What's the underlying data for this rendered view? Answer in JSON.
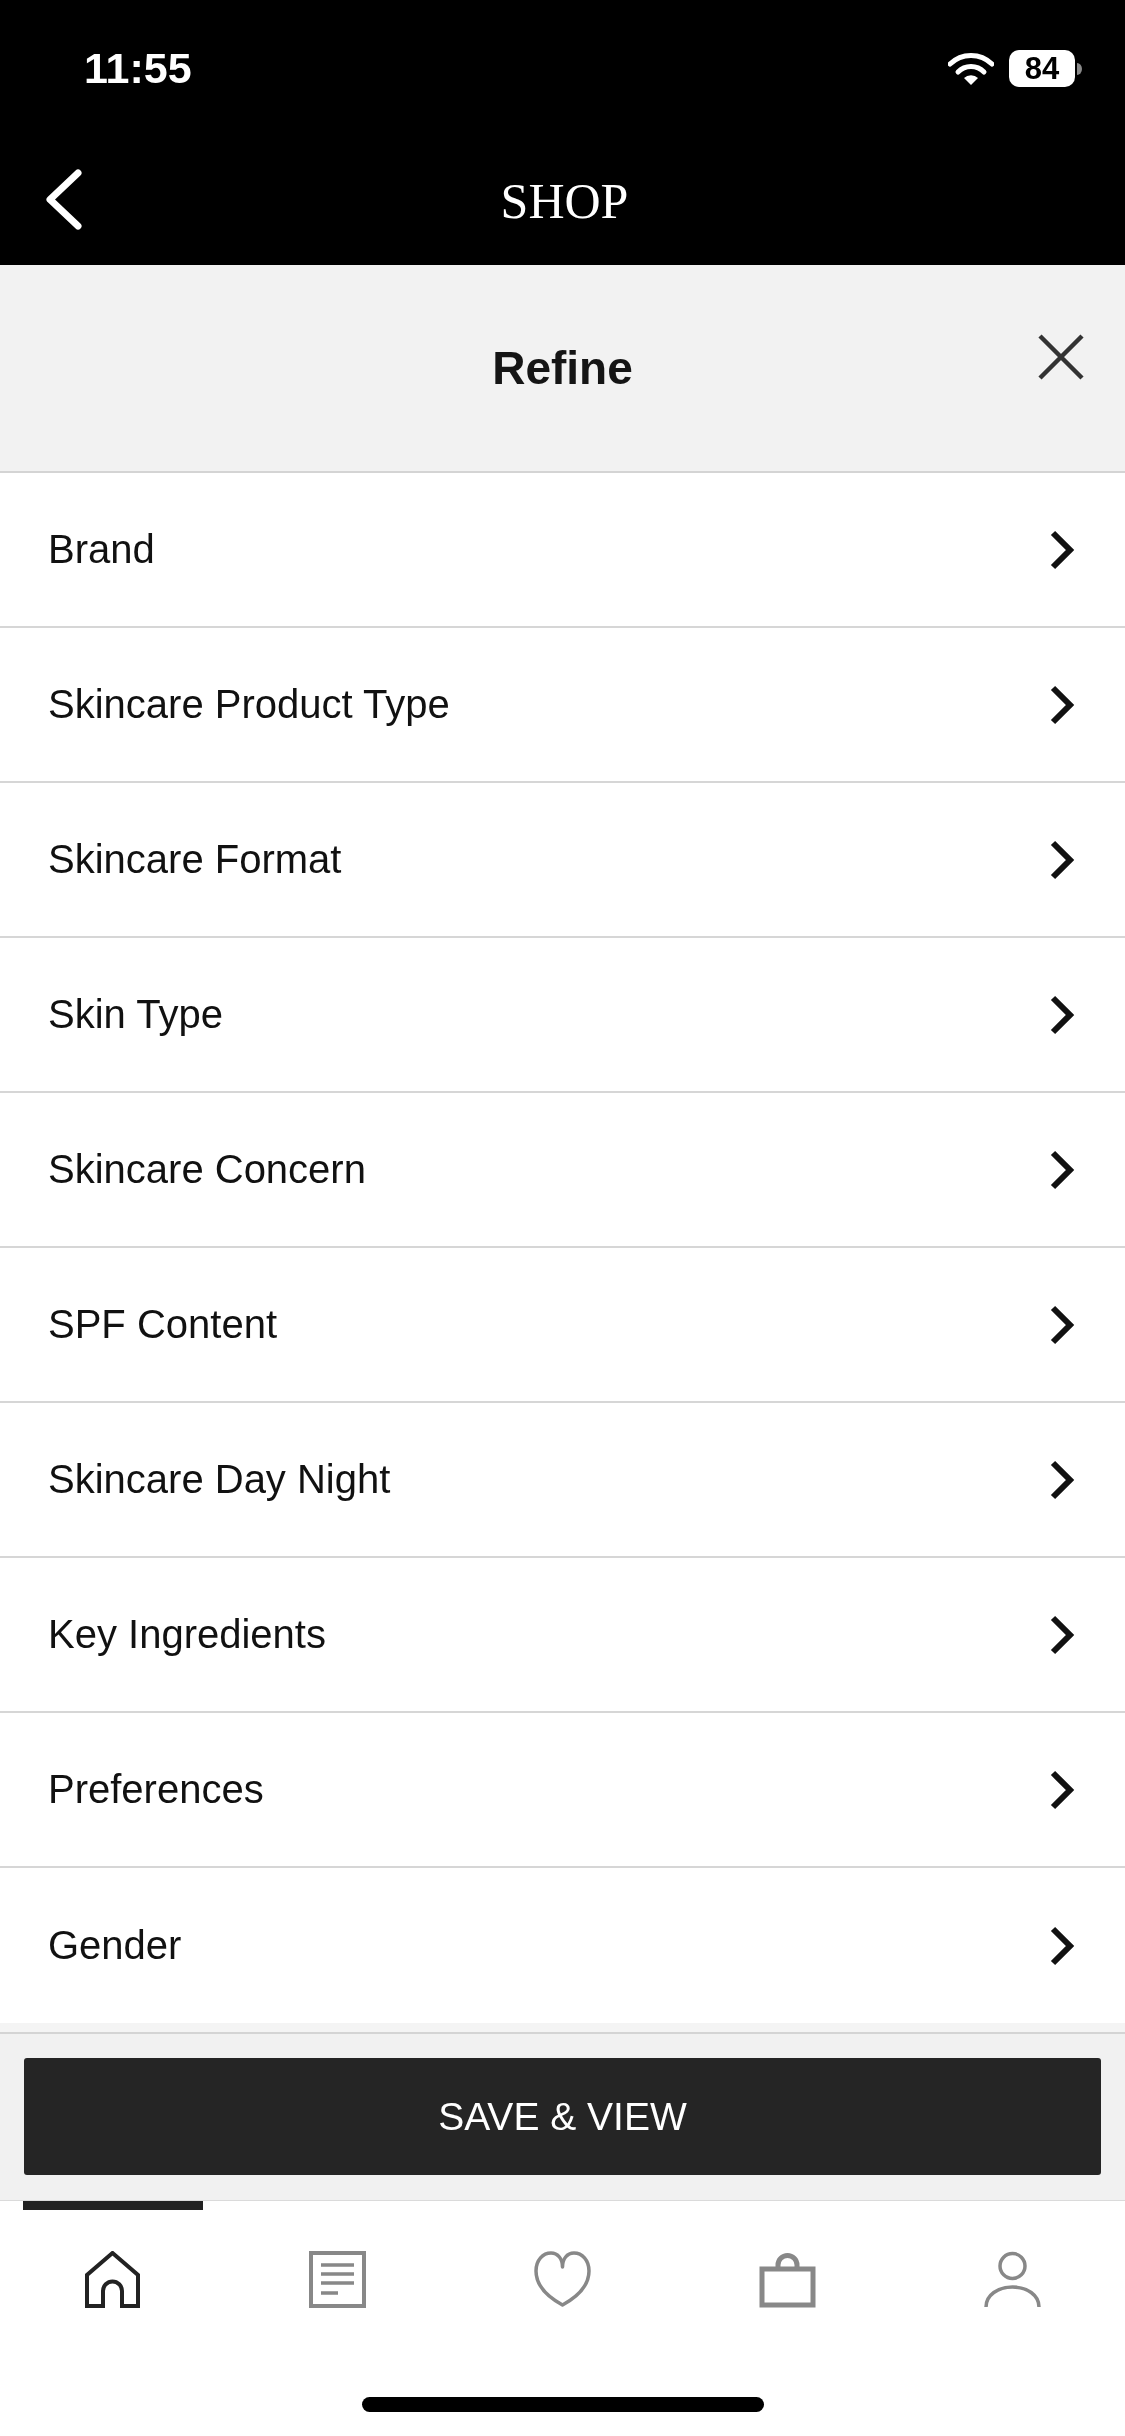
{
  "status_bar": {
    "time": "11:55",
    "battery": "84"
  },
  "nav_bar": {
    "title": "SHOP"
  },
  "panel": {
    "title": "Refine"
  },
  "filters": [
    "Brand",
    "Skincare Product Type",
    "Skincare Format",
    "Skin Type",
    "Skincare Concern",
    "SPF Content",
    "Skincare Day Night",
    "Key Ingredients",
    "Preferences",
    "Gender"
  ],
  "action_button": "SAVE & VIEW",
  "tab_bar": [
    {
      "kind": "home",
      "selected": true
    },
    {
      "kind": "list",
      "selected": false
    },
    {
      "kind": "heart",
      "selected": false
    },
    {
      "kind": "bag",
      "selected": false
    },
    {
      "kind": "person",
      "selected": false
    }
  ]
}
